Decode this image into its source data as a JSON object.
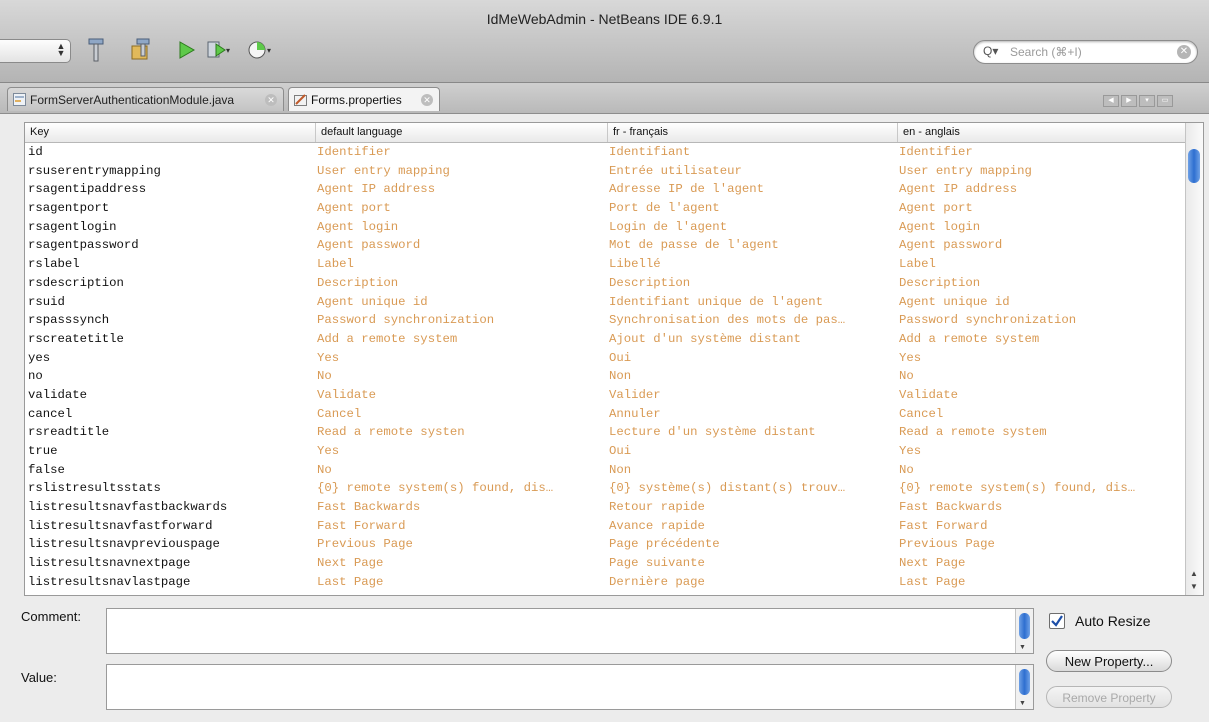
{
  "window": {
    "title": "IdMeWebAdmin - NetBeans IDE 6.9.1"
  },
  "toolbar": {
    "search_placeholder": "Search (⌘+I)",
    "icons": [
      "clean-build-icon",
      "build-icon",
      "run-icon",
      "debug-icon",
      "profile-icon"
    ]
  },
  "tabs": [
    {
      "label": "FormServerAuthenticationModule.java",
      "active": false
    },
    {
      "label": "Forms.properties",
      "active": true
    }
  ],
  "table": {
    "headers": [
      "Key",
      "default language",
      "fr - français",
      "en - anglais"
    ],
    "rows": [
      [
        "id",
        "Identifier",
        "Identifiant",
        "Identifier"
      ],
      [
        "rsuserentrymapping",
        "User entry mapping",
        "Entrée utilisateur",
        "User entry mapping"
      ],
      [
        "rsagentipaddress",
        "Agent IP address",
        "Adresse IP de l'agent",
        "Agent IP address"
      ],
      [
        "rsagentport",
        "Agent port",
        "Port de l'agent",
        "Agent port"
      ],
      [
        "rsagentlogin",
        "Agent login",
        "Login de l'agent",
        "Agent login"
      ],
      [
        "rsagentpassword",
        "Agent password",
        "Mot de passe de l'agent",
        "Agent password"
      ],
      [
        "rslabel",
        "Label",
        "Libellé",
        "Label"
      ],
      [
        "rsdescription",
        "Description",
        "Description",
        "Description"
      ],
      [
        "rsuid",
        "Agent unique id",
        "Identifiant unique de l'agent",
        "Agent unique id"
      ],
      [
        "rspasssynch",
        "Password synchronization",
        "Synchronisation des mots de pas…",
        "Password synchronization"
      ],
      [
        "rscreatetitle",
        "Add a remote system",
        "Ajout d'un système distant",
        "Add a remote system"
      ],
      [
        "yes",
        "Yes",
        "Oui",
        "Yes"
      ],
      [
        "no",
        "No",
        "Non",
        "No"
      ],
      [
        "validate",
        "Validate",
        "Valider",
        "Validate"
      ],
      [
        "cancel",
        "Cancel",
        "Annuler",
        "Cancel"
      ],
      [
        "rsreadtitle",
        "Read a remote systen",
        "Lecture d'un système distant",
        "Read a remote system"
      ],
      [
        "true",
        "Yes",
        "Oui",
        "Yes"
      ],
      [
        "false",
        "No",
        "Non",
        "No"
      ],
      [
        "rslistresultsstats",
        "{0} remote system(s) found, dis…",
        "{0} système(s) distant(s) trouv…",
        "{0} remote system(s) found, dis…"
      ],
      [
        "listresultsnavfastbackwards",
        "Fast Backwards",
        "Retour rapide",
        "Fast Backwards"
      ],
      [
        "listresultsnavfastforward",
        "Fast Forward",
        "Avance rapide",
        "Fast Forward"
      ],
      [
        "listresultsnavpreviouspage",
        "Previous Page",
        "Page précédente",
        "Previous Page"
      ],
      [
        "listresultsnavnextpage",
        "Next Page",
        "Page suivante",
        "Next Page"
      ],
      [
        "listresultsnavlastpage",
        "Last Page",
        "Dernière page",
        "Last Page"
      ]
    ]
  },
  "editor": {
    "comment_label": "Comment:",
    "comment_value": "",
    "value_label": "Value:",
    "value_value": "",
    "auto_resize_label": "Auto Resize",
    "auto_resize_checked": true,
    "new_property_label": "New Property...",
    "remove_property_label": "Remove Property"
  },
  "colors": {
    "translation_text": "#d99a54",
    "scroll_thumb": "#2e6fd0"
  }
}
